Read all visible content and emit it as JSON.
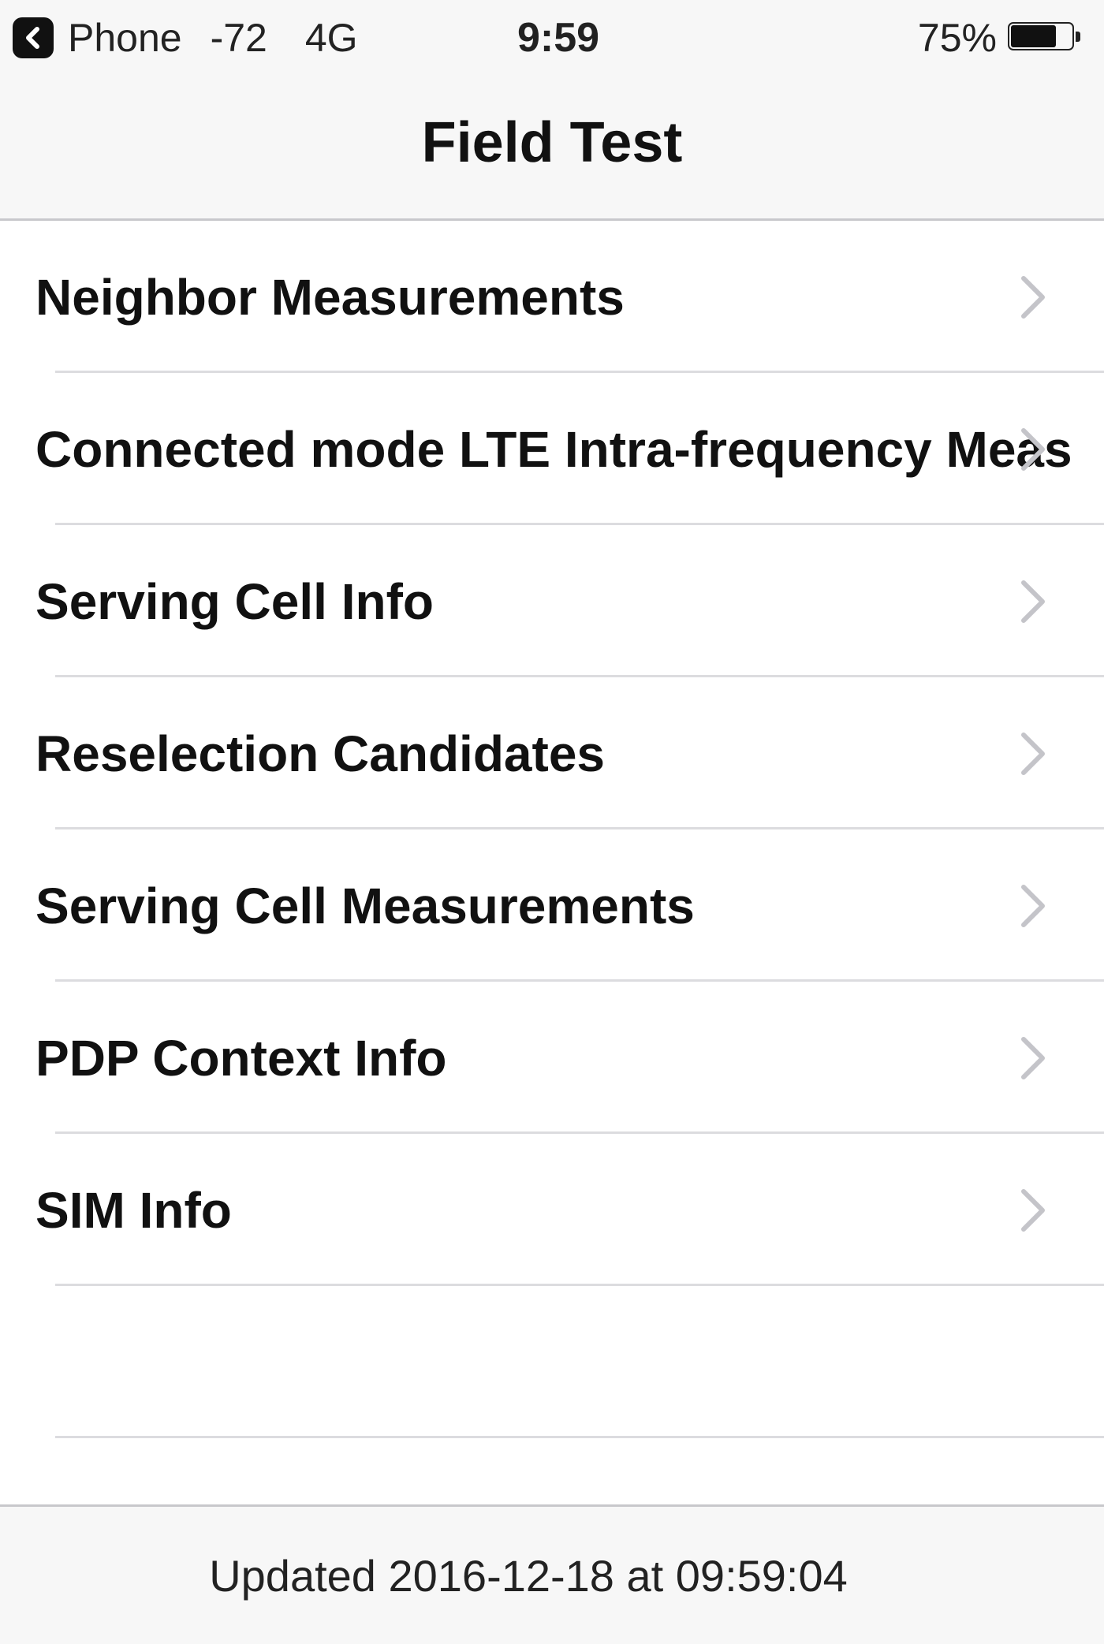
{
  "status_bar": {
    "back_app": "Phone",
    "signal": "-72",
    "network": "4G",
    "time": "9:59",
    "battery_percent": "75%",
    "battery_level": 0.75
  },
  "nav": {
    "title": "Field Test"
  },
  "rows": [
    {
      "label": "Neighbor Measurements"
    },
    {
      "label": "Connected mode LTE Intra-frequency Meas"
    },
    {
      "label": "Serving Cell Info"
    },
    {
      "label": "Reselection Candidates"
    },
    {
      "label": "Serving Cell Measurements"
    },
    {
      "label": "PDP Context Info"
    },
    {
      "label": "SIM Info"
    }
  ],
  "footer": {
    "updated": "Updated 2016-12-18 at 09:59:04"
  },
  "colors": {
    "bar_background": "#f7f7f7",
    "separator": "#dcdcdf",
    "chevron": "#c4c4c9",
    "text": "#111111"
  },
  "icons": {
    "back_app": "back-arrow-icon",
    "battery": "battery-icon",
    "row_disclosure": "chevron-right-icon"
  }
}
